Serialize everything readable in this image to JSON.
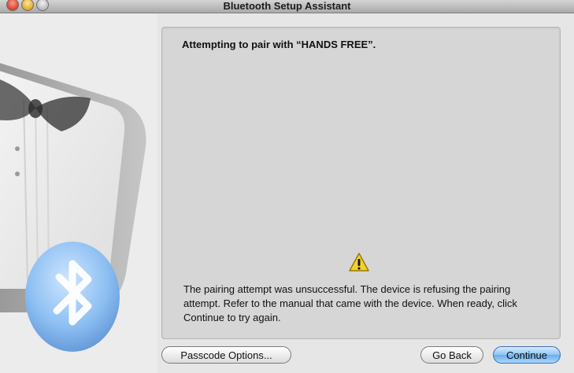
{
  "window": {
    "title": "Bluetooth Setup Assistant"
  },
  "panel": {
    "title": "Attempting to pair with “HANDS FREE”.",
    "message": "The pairing attempt was unsuccessful. The device is refusing the pairing attempt. Refer to the manual that came with the device. When ready, click Continue to try again.",
    "icon": "warning-icon"
  },
  "buttons": {
    "passcode_options": "Passcode Options...",
    "go_back": "Go Back",
    "continue": "Continue"
  },
  "colors": {
    "accent": "#6aaeea",
    "warning": "#f2d233"
  }
}
